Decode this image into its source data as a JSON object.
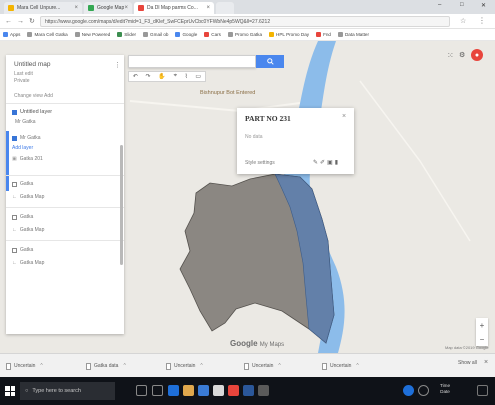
{
  "colors": {
    "river": "#8cbcea",
    "parcel": "#8b8782",
    "parcel_highlight": "#5c7fb0",
    "map_bg": "#ebe9e4",
    "accent": "#4a87ee",
    "taskbar": "#0f1218"
  },
  "browser": {
    "tabs": [
      {
        "label": "Mara Cell Unpure...",
        "active": false
      },
      {
        "label": "Google Map",
        "active": false
      },
      {
        "label": "Da Dl Map parms Co...",
        "active": true
      },
      {
        "label": "",
        "active": false
      }
    ],
    "window_controls": [
      "–",
      "□",
      "✕"
    ],
    "url": "https://www.google.com/maps/d/edit?mid=1_F3_dKlef_SwFCEprUvCbc0YFWbNe4p5WQ&ll=27.6212",
    "bookmarks": [
      "Apps",
      "Mara Cell Gatka",
      "New Powered",
      "Slider",
      "Gmail ob",
      "Google",
      "Cars",
      "Promo Gatka",
      "HPL Promo Day",
      "Fnd",
      "Data Matter"
    ]
  },
  "map": {
    "toolbar_icons": [
      "hand-icon",
      "marker-icon",
      "line-icon",
      "route-icon",
      "ruler-icon"
    ],
    "place_label": "Bishnupur Bot Entered",
    "google_logo": "Google",
    "google_logo_suffix": "My Maps",
    "footer": "Map data ©2019 Google",
    "zoom_in": "+",
    "zoom_out": "−"
  },
  "panel": {
    "title": "Untitled map",
    "subtitle_1": "Last edit",
    "subtitle_2": "Private",
    "add_layer": "Change view   Add",
    "layer_head": "Untitled layer",
    "rows": [
      {
        "lead": "",
        "text": "Mr Gatka",
        "type": "layer"
      },
      {
        "lead": "",
        "text": "Add layer",
        "type": "link"
      },
      {
        "lead": "",
        "text": "Gatka 201",
        "type": "item"
      },
      {
        "lead": "",
        "text": "Gatka",
        "type": "check"
      },
      {
        "lead": "",
        "text": "Gatka Map",
        "type": "item"
      },
      {
        "lead": "",
        "text": "Gatka",
        "type": "check"
      },
      {
        "lead": "",
        "text": "Gatka Map",
        "type": "item"
      },
      {
        "lead": "",
        "text": "Gatka",
        "type": "check"
      },
      {
        "lead": "",
        "text": "Gatka Map",
        "type": "item"
      }
    ]
  },
  "card": {
    "title": "PART NO 231",
    "meta": "No data",
    "bottom_label": "Style settings"
  },
  "downloads": [
    {
      "label": "Uncertain"
    },
    {
      "label": "Gatka data"
    },
    {
      "label": "Uncertain"
    },
    {
      "label": "Uncertain"
    },
    {
      "label": "Uncertain"
    }
  ],
  "downloads_show_all": "Show all",
  "taskbar": {
    "search_placeholder": "Type here to search",
    "time": "Time",
    "date": "Date"
  }
}
